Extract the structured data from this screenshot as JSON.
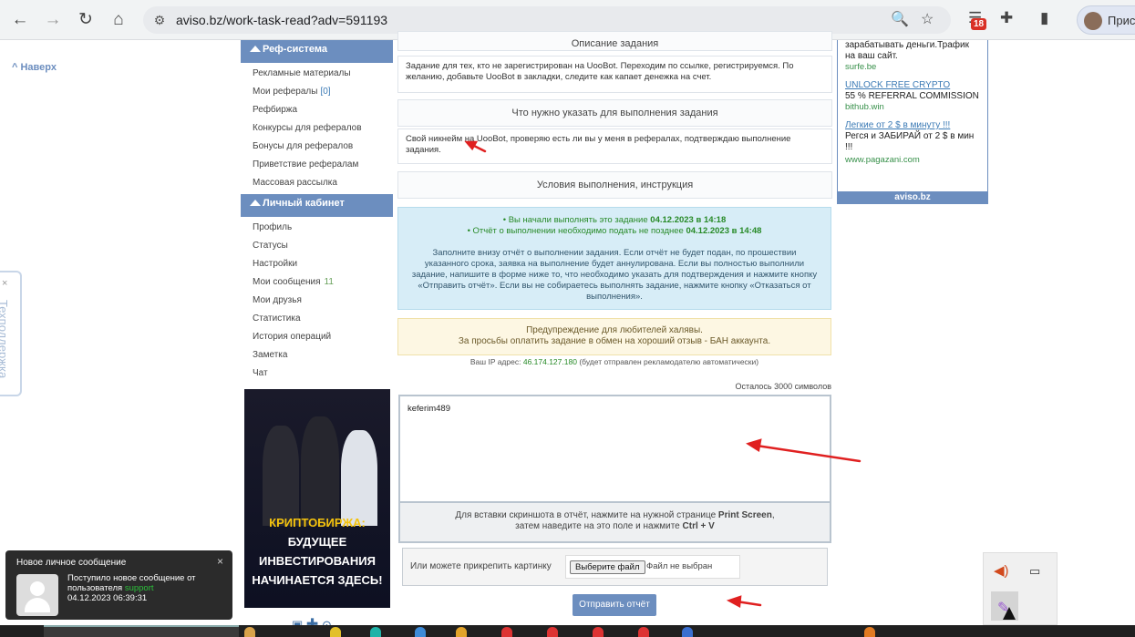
{
  "browser": {
    "url": "aviso.bz/work-task-read?adv=591193",
    "badge_count": "18",
    "profile_label": "Прис"
  },
  "page": {
    "scroll_top_label": "Наверх",
    "support_tab_label": "Техподдержка",
    "close_label": "×"
  },
  "left_menu": {
    "ref_header": "Реф-система",
    "ref_items": [
      {
        "label": "Рекламные материалы",
        "count": ""
      },
      {
        "label": "Мои рефералы",
        "count": "[0]"
      },
      {
        "label": "Рефбиржа",
        "count": ""
      },
      {
        "label": "Конкурсы для рефералов",
        "count": ""
      },
      {
        "label": "Бонусы для рефералов",
        "count": ""
      },
      {
        "label": "Приветствие рефералам",
        "count": ""
      },
      {
        "label": "Массовая рассылка",
        "count": ""
      }
    ],
    "cabinet_header": "Личный кабинет",
    "cabinet_items": [
      {
        "label": "Профиль",
        "count": ""
      },
      {
        "label": "Статусы",
        "count": ""
      },
      {
        "label": "Настройки",
        "count": ""
      },
      {
        "label": "Мои сообщения",
        "count": "11"
      },
      {
        "label": "Мои друзья",
        "count": ""
      },
      {
        "label": "Статистика",
        "count": ""
      },
      {
        "label": "История операций",
        "count": ""
      },
      {
        "label": "Заметка",
        "count": ""
      },
      {
        "label": "Чат",
        "count": ""
      }
    ],
    "banner_lines": [
      "КРИПТОБИРЖА:",
      "БУДУЩЕЕ",
      "ИНВЕСТИРОВАНИЯ",
      "НАЧИНАЕТСЯ ЗДЕСЬ!"
    ]
  },
  "task": {
    "description_title": "Описание задания",
    "description_text": "Задание для тех, кто не зарегистрирован на UooBot. Переходим по ссылке, регистрируемся. По желанию, добавьте UooBot в закладки, следите как капает денежка на счет.",
    "required_title": "Что нужно указать для выполнения задания",
    "required_text": "Свой никнейм на UooBot, проверяю есть ли вы у меня в рефералах, подтверждаю выполнение задания.",
    "conditions_title": "Условия выполнения, инструкция",
    "started_prefix": "• Вы начали выполнять это задание ",
    "started_date": "04.12.2023 в 14:18",
    "deadline_prefix": "• Отчёт о выполнении необходимо подать не позднее ",
    "deadline_date": "04.12.2023 в 14:48",
    "instructions": "Заполните внизу отчёт о выполнении задания. Если отчёт не будет подан, по прошествии указанного срока, заявка на выполнение будет аннулирована. Если вы полностью выполнили задание, напишите в форме ниже то, что необходимо указать для подтверждения и нажмите кнопку «Отправить отчёт». Если вы не собираетесь выполнять задание, нажмите кнопку «Отказаться от выполнения».",
    "warning_title": "Предупреждение для любителей халявы.",
    "warning_text": "За просьбы оплатить задание в обмен на хороший отзыв - БАН аккаунта.",
    "ip_label": "Ваш IP адрес:",
    "ip_value": "46.174.127.180",
    "ip_note": "(будет отправлен рекламодателю автоматически)",
    "chars_left": "Осталось 3000 символов",
    "report_value": "keferim489",
    "paste_hint_1": "Для вставки скриншота в отчёт, нажмите на нужной странице ",
    "paste_hint_key1": "Print Screen",
    "paste_hint_2": "затем наведите на это поле и нажмите ",
    "paste_hint_key2": "Ctrl + V",
    "attach_label": "Или можете прикрепить картинку",
    "file_button": "Выберите файл",
    "file_none": "Файл не выбран",
    "submit_label": "Отправить отчёт"
  },
  "ads": {
    "top_text": "зарабатывать деньги.Трафик на ваш сайт.",
    "top_domain": "surfe.be",
    "items": [
      {
        "title": "UNLOCK FREE CRYPTO",
        "text": "55 % REFERRAL COMMISSION",
        "domain": "bithub.win"
      },
      {
        "title": "Легкие от 2 $ в минуту !!!",
        "text": "Регся и ЗАБИРАЙ от 2 $ в мин !!!",
        "domain": "www.pagazani.com"
      }
    ],
    "footer": "aviso.bz"
  },
  "notification": {
    "title": "Новое личное сообщение",
    "body": "Поступило новое сообщение от пользователя",
    "sender": "support",
    "time": "04.12.2023 06:39:31"
  }
}
